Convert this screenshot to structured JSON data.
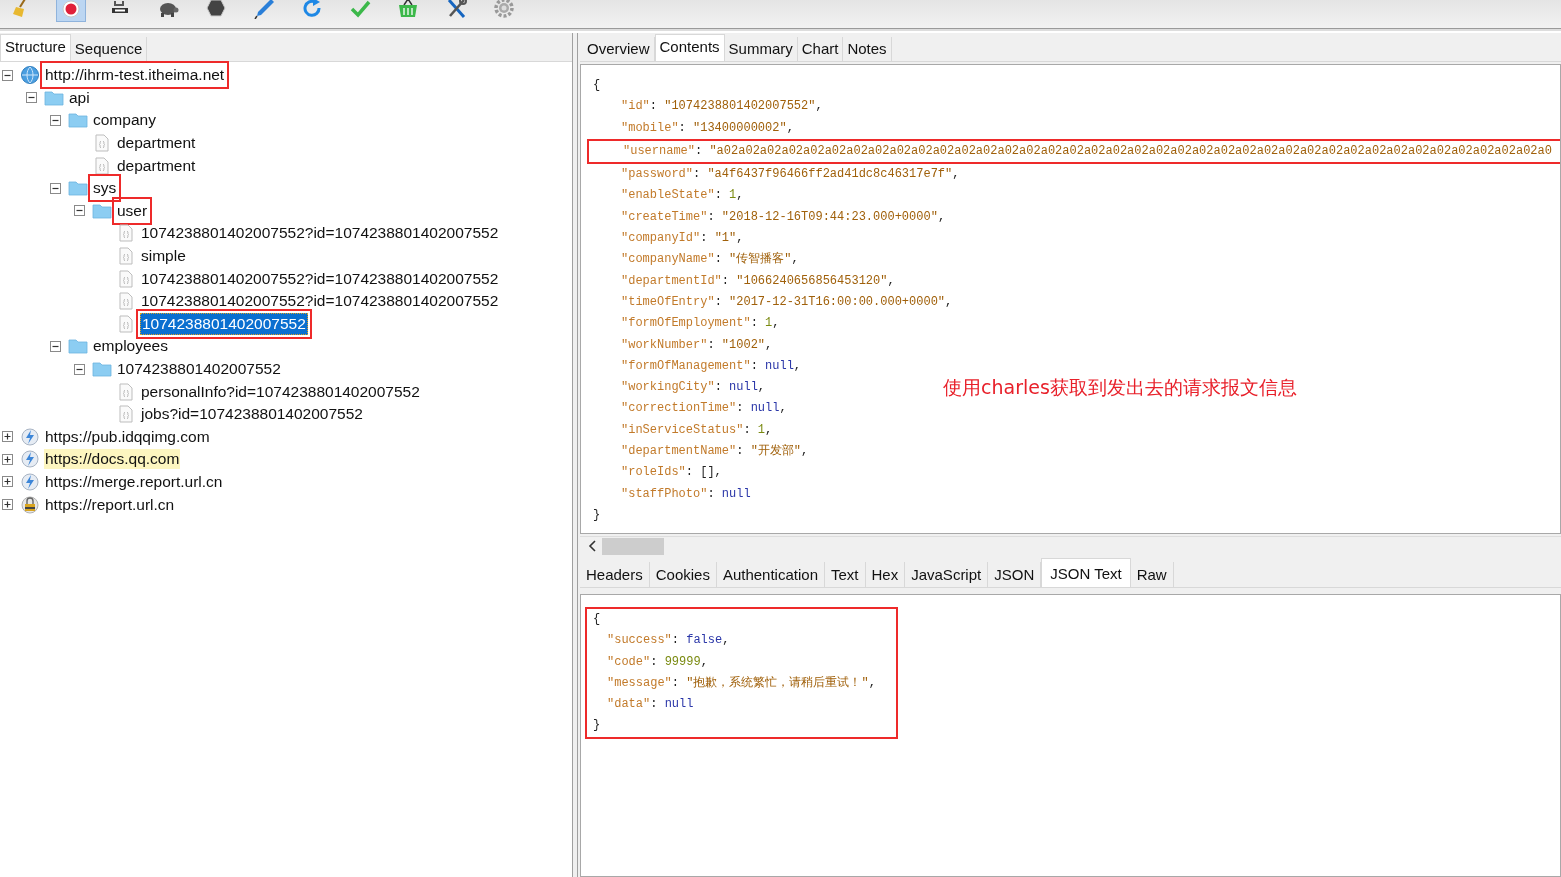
{
  "toolbar": {
    "icons": [
      {
        "kind": "broom",
        "selected": false
      },
      {
        "kind": "record",
        "selected": true
      },
      {
        "kind": "throttle",
        "selected": false
      },
      {
        "kind": "turtle",
        "selected": false
      },
      {
        "kind": "stop",
        "selected": false
      },
      {
        "kind": "pen",
        "selected": false
      },
      {
        "kind": "refresh",
        "selected": false
      },
      {
        "kind": "check",
        "selected": false
      },
      {
        "kind": "basket",
        "selected": false
      },
      {
        "kind": "tools",
        "selected": false
      },
      {
        "kind": "gear",
        "selected": false
      }
    ]
  },
  "left_tabs": [
    {
      "label": "Structure",
      "selected": true
    },
    {
      "label": "Sequence",
      "selected": false
    }
  ],
  "tree": [
    {
      "kind": "host",
      "label": "http://ihrm-test.itheima.net",
      "expanded": true,
      "selected": false,
      "highlighted": false,
      "outlined": true,
      "children": [
        {
          "kind": "folder",
          "label": "api",
          "expanded": true,
          "selected": false,
          "highlighted": false,
          "outlined": false,
          "children": [
            {
              "kind": "folder",
              "label": "company",
              "expanded": true,
              "selected": false,
              "highlighted": false,
              "outlined": false,
              "children": [
                {
                  "kind": "file",
                  "label": "department",
                  "selected": false,
                  "highlighted": false,
                  "outlined": false
                },
                {
                  "kind": "file",
                  "label": "department",
                  "selected": false,
                  "highlighted": false,
                  "outlined": false
                }
              ]
            },
            {
              "kind": "folder",
              "label": "sys",
              "expanded": true,
              "selected": false,
              "highlighted": false,
              "outlined": true,
              "children": [
                {
                  "kind": "folder",
                  "label": "user",
                  "expanded": true,
                  "selected": false,
                  "highlighted": false,
                  "outlined": true,
                  "children": [
                    {
                      "kind": "file",
                      "label": "1074238801402007552?id=1074238801402007552",
                      "selected": false,
                      "highlighted": false,
                      "outlined": false
                    },
                    {
                      "kind": "file",
                      "label": "simple",
                      "selected": false,
                      "highlighted": false,
                      "outlined": false
                    },
                    {
                      "kind": "file",
                      "label": "1074238801402007552?id=1074238801402007552",
                      "selected": false,
                      "highlighted": false,
                      "outlined": false
                    },
                    {
                      "kind": "file",
                      "label": "1074238801402007552?id=1074238801402007552",
                      "selected": false,
                      "highlighted": false,
                      "outlined": false
                    },
                    {
                      "kind": "file",
                      "label": "1074238801402007552",
                      "selected": true,
                      "highlighted": false,
                      "outlined": true
                    }
                  ]
                }
              ]
            },
            {
              "kind": "folder",
              "label": "employees",
              "expanded": true,
              "selected": false,
              "highlighted": false,
              "outlined": false,
              "children": [
                {
                  "kind": "folder",
                  "label": "1074238801402007552",
                  "expanded": true,
                  "selected": false,
                  "highlighted": false,
                  "outlined": false,
                  "children": [
                    {
                      "kind": "file",
                      "label": "personalInfo?id=1074238801402007552",
                      "selected": false,
                      "highlighted": false,
                      "outlined": false
                    },
                    {
                      "kind": "file",
                      "label": "jobs?id=1074238801402007552",
                      "selected": false,
                      "highlighted": false,
                      "outlined": false
                    }
                  ]
                }
              ]
            }
          ]
        }
      ]
    },
    {
      "kind": "secure_host",
      "label": "https://pub.idqqimg.com",
      "expanded": false,
      "selected": false,
      "highlighted": false,
      "outlined": false
    },
    {
      "kind": "secure_host",
      "label": "https://docs.qq.com",
      "expanded": false,
      "selected": false,
      "highlighted": true,
      "outlined": false
    },
    {
      "kind": "secure_host",
      "label": "https://merge.report.url.cn",
      "expanded": false,
      "selected": false,
      "highlighted": false,
      "outlined": false
    },
    {
      "kind": "locked_host",
      "label": "https://report.url.cn",
      "expanded": false,
      "selected": false,
      "highlighted": false,
      "outlined": false
    }
  ],
  "right_tabs": [
    {
      "label": "Overview",
      "selected": false
    },
    {
      "label": "Contents",
      "selected": true
    },
    {
      "label": "Summary",
      "selected": false
    },
    {
      "label": "Chart",
      "selected": false
    },
    {
      "label": "Notes",
      "selected": false
    }
  ],
  "request_body": {
    "lines": [
      {
        "indent": false,
        "outlined": false,
        "tokens": [
          {
            "kind": "punct",
            "text": "{"
          }
        ]
      },
      {
        "indent": true,
        "outlined": false,
        "tokens": [
          {
            "kind": "key",
            "text": "\"id\""
          },
          {
            "kind": "punct",
            "text": ": "
          },
          {
            "kind": "string",
            "text": "\"1074238801402007552\""
          },
          {
            "kind": "punct",
            "text": ","
          }
        ]
      },
      {
        "indent": true,
        "outlined": false,
        "tokens": [
          {
            "kind": "key",
            "text": "\"mobile\""
          },
          {
            "kind": "punct",
            "text": ": "
          },
          {
            "kind": "string",
            "text": "\"13400000002\""
          },
          {
            "kind": "punct",
            "text": ","
          }
        ]
      },
      {
        "indent": true,
        "outlined": true,
        "tokens": [
          {
            "kind": "key",
            "text": "\"username\""
          },
          {
            "kind": "punct",
            "text": ": "
          },
          {
            "kind": "string",
            "text": "\"a02a02a02a02a02a02a02a02a02a02a02a02a02a02a02a02a02a02a02a02a02a02a02a02a02a02a02a02a02a02a02a02a02a02a02a02a02a02a0"
          }
        ]
      },
      {
        "indent": true,
        "outlined": false,
        "tokens": [
          {
            "kind": "key",
            "text": "\"password\""
          },
          {
            "kind": "punct",
            "text": ": "
          },
          {
            "kind": "string",
            "text": "\"a4f6437f96466ff2ad41dc8c46317e7f\""
          },
          {
            "kind": "punct",
            "text": ","
          }
        ]
      },
      {
        "indent": true,
        "outlined": false,
        "tokens": [
          {
            "kind": "key",
            "text": "\"enableState\""
          },
          {
            "kind": "punct",
            "text": ": "
          },
          {
            "kind": "number",
            "text": "1"
          },
          {
            "kind": "punct",
            "text": ","
          }
        ]
      },
      {
        "indent": true,
        "outlined": false,
        "tokens": [
          {
            "kind": "key",
            "text": "\"createTime\""
          },
          {
            "kind": "punct",
            "text": ": "
          },
          {
            "kind": "string",
            "text": "\"2018-12-16T09:44:23.000+0000\""
          },
          {
            "kind": "punct",
            "text": ","
          }
        ]
      },
      {
        "indent": true,
        "outlined": false,
        "tokens": [
          {
            "kind": "key",
            "text": "\"companyId\""
          },
          {
            "kind": "punct",
            "text": ": "
          },
          {
            "kind": "string",
            "text": "\"1\""
          },
          {
            "kind": "punct",
            "text": ","
          }
        ]
      },
      {
        "indent": true,
        "outlined": false,
        "tokens": [
          {
            "kind": "key",
            "text": "\"companyName\""
          },
          {
            "kind": "punct",
            "text": ": "
          },
          {
            "kind": "string",
            "text": "\"传智播客\""
          },
          {
            "kind": "punct",
            "text": ","
          }
        ]
      },
      {
        "indent": true,
        "outlined": false,
        "tokens": [
          {
            "kind": "key",
            "text": "\"departmentId\""
          },
          {
            "kind": "punct",
            "text": ": "
          },
          {
            "kind": "string",
            "text": "\"1066240656856453120\""
          },
          {
            "kind": "punct",
            "text": ","
          }
        ]
      },
      {
        "indent": true,
        "outlined": false,
        "tokens": [
          {
            "kind": "key",
            "text": "\"timeOfEntry\""
          },
          {
            "kind": "punct",
            "text": ": "
          },
          {
            "kind": "string",
            "text": "\"2017-12-31T16:00:00.000+0000\""
          },
          {
            "kind": "punct",
            "text": ","
          }
        ]
      },
      {
        "indent": true,
        "outlined": false,
        "tokens": [
          {
            "kind": "key",
            "text": "\"formOfEmployment\""
          },
          {
            "kind": "punct",
            "text": ": "
          },
          {
            "kind": "number",
            "text": "1"
          },
          {
            "kind": "punct",
            "text": ","
          }
        ]
      },
      {
        "indent": true,
        "outlined": false,
        "tokens": [
          {
            "kind": "key",
            "text": "\"workNumber\""
          },
          {
            "kind": "punct",
            "text": ": "
          },
          {
            "kind": "string",
            "text": "\"1002\""
          },
          {
            "kind": "punct",
            "text": ","
          }
        ]
      },
      {
        "indent": true,
        "outlined": false,
        "tokens": [
          {
            "kind": "key",
            "text": "\"formOfManagement\""
          },
          {
            "kind": "punct",
            "text": ": "
          },
          {
            "kind": "literal",
            "text": "null"
          },
          {
            "kind": "punct",
            "text": ","
          }
        ]
      },
      {
        "indent": true,
        "outlined": false,
        "tokens": [
          {
            "kind": "key",
            "text": "\"workingCity\""
          },
          {
            "kind": "punct",
            "text": ": "
          },
          {
            "kind": "literal",
            "text": "null"
          },
          {
            "kind": "punct",
            "text": ","
          }
        ]
      },
      {
        "indent": true,
        "outlined": false,
        "tokens": [
          {
            "kind": "key",
            "text": "\"correctionTime\""
          },
          {
            "kind": "punct",
            "text": ": "
          },
          {
            "kind": "literal",
            "text": "null"
          },
          {
            "kind": "punct",
            "text": ","
          }
        ]
      },
      {
        "indent": true,
        "outlined": false,
        "tokens": [
          {
            "kind": "key",
            "text": "\"inServiceStatus\""
          },
          {
            "kind": "punct",
            "text": ": "
          },
          {
            "kind": "number",
            "text": "1"
          },
          {
            "kind": "punct",
            "text": ","
          }
        ]
      },
      {
        "indent": true,
        "outlined": false,
        "tokens": [
          {
            "kind": "key",
            "text": "\"departmentName\""
          },
          {
            "kind": "punct",
            "text": ": "
          },
          {
            "kind": "string",
            "text": "\"开发部\""
          },
          {
            "kind": "punct",
            "text": ","
          }
        ]
      },
      {
        "indent": true,
        "outlined": false,
        "tokens": [
          {
            "kind": "key",
            "text": "\"roleIds\""
          },
          {
            "kind": "punct",
            "text": ": [],"
          }
        ]
      },
      {
        "indent": true,
        "outlined": false,
        "tokens": [
          {
            "kind": "key",
            "text": "\"staffPhoto\""
          },
          {
            "kind": "punct",
            "text": ": "
          },
          {
            "kind": "literal",
            "text": "null"
          }
        ]
      },
      {
        "indent": false,
        "outlined": false,
        "tokens": [
          {
            "kind": "punct",
            "text": "}"
          }
        ]
      }
    ]
  },
  "annotation": "使用charles获取到发出去的请求报文信息",
  "body_tabs": [
    {
      "label": "Headers",
      "selected": false
    },
    {
      "label": "Cookies",
      "selected": false
    },
    {
      "label": "Authentication",
      "selected": false
    },
    {
      "label": "Text",
      "selected": false
    },
    {
      "label": "Hex",
      "selected": false
    },
    {
      "label": "JavaScript",
      "selected": false
    },
    {
      "label": "JSON",
      "selected": false
    },
    {
      "label": "JSON Text",
      "selected": true
    },
    {
      "label": "Raw",
      "selected": false
    }
  ],
  "response_body": {
    "lines": [
      {
        "indent": false,
        "outlined": true,
        "tokens": [
          {
            "kind": "punct",
            "text": "{"
          }
        ]
      },
      {
        "indent": true,
        "outlined": true,
        "tokens": [
          {
            "kind": "key",
            "text": "\"success\""
          },
          {
            "kind": "punct",
            "text": ": "
          },
          {
            "kind": "literal",
            "text": "false"
          },
          {
            "kind": "punct",
            "text": ","
          }
        ]
      },
      {
        "indent": true,
        "outlined": true,
        "tokens": [
          {
            "kind": "key",
            "text": "\"code\""
          },
          {
            "kind": "punct",
            "text": ": "
          },
          {
            "kind": "number",
            "text": "99999"
          },
          {
            "kind": "punct",
            "text": ","
          }
        ]
      },
      {
        "indent": true,
        "outlined": true,
        "tokens": [
          {
            "kind": "key",
            "text": "\"message\""
          },
          {
            "kind": "punct",
            "text": ": "
          },
          {
            "kind": "string",
            "text": "\"抱歉，系统繁忙，请稍后重试！\""
          },
          {
            "kind": "punct",
            "text": ","
          }
        ]
      },
      {
        "indent": true,
        "outlined": true,
        "tokens": [
          {
            "kind": "key",
            "text": "\"data\""
          },
          {
            "kind": "punct",
            "text": ": "
          },
          {
            "kind": "literal",
            "text": "null"
          }
        ]
      },
      {
        "indent": false,
        "outlined": true,
        "tokens": [
          {
            "kind": "punct",
            "text": "}"
          }
        ]
      }
    ]
  }
}
